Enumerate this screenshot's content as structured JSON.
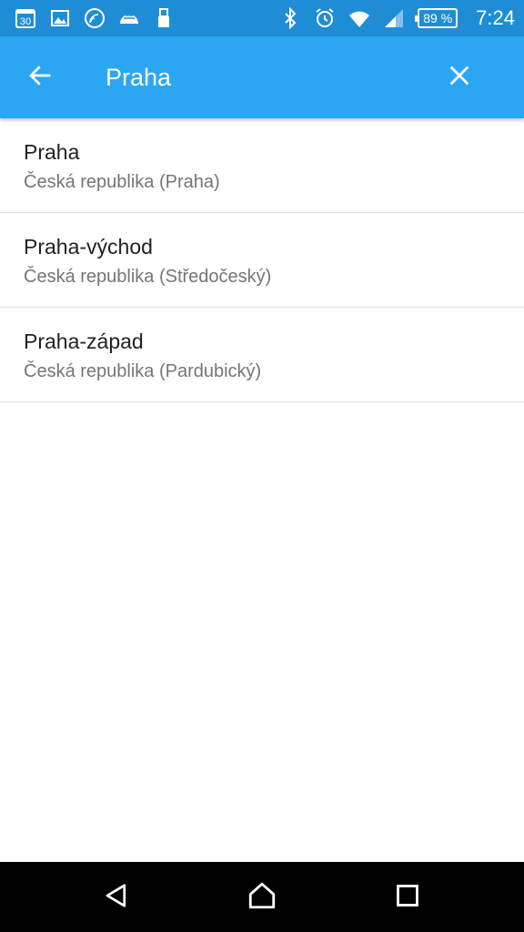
{
  "status_bar": {
    "left_icons": [
      "calendar-icon",
      "gallery-icon",
      "cast-icon",
      "weather-icon",
      "usb-icon"
    ],
    "calendar_day": "30",
    "right_icons": [
      "bluetooth-icon",
      "alarm-icon",
      "wifi-icon",
      "signal-icon"
    ],
    "battery": "89 %",
    "time": "7:24"
  },
  "app_bar": {
    "background_color": "#2aa6f2",
    "back_icon": "arrow-back-icon",
    "search_value": "Praha",
    "clear_icon": "close-icon"
  },
  "results": [
    {
      "title": "Praha",
      "subtitle": "Česká republika (Praha)"
    },
    {
      "title": "Praha-východ",
      "subtitle": "Česká republika (Středočeský)"
    },
    {
      "title": "Praha-západ",
      "subtitle": "Česká republika (Pardubický)"
    }
  ],
  "nav_bar": {
    "buttons": [
      "back-triangle-icon",
      "home-icon",
      "recents-icon"
    ]
  }
}
